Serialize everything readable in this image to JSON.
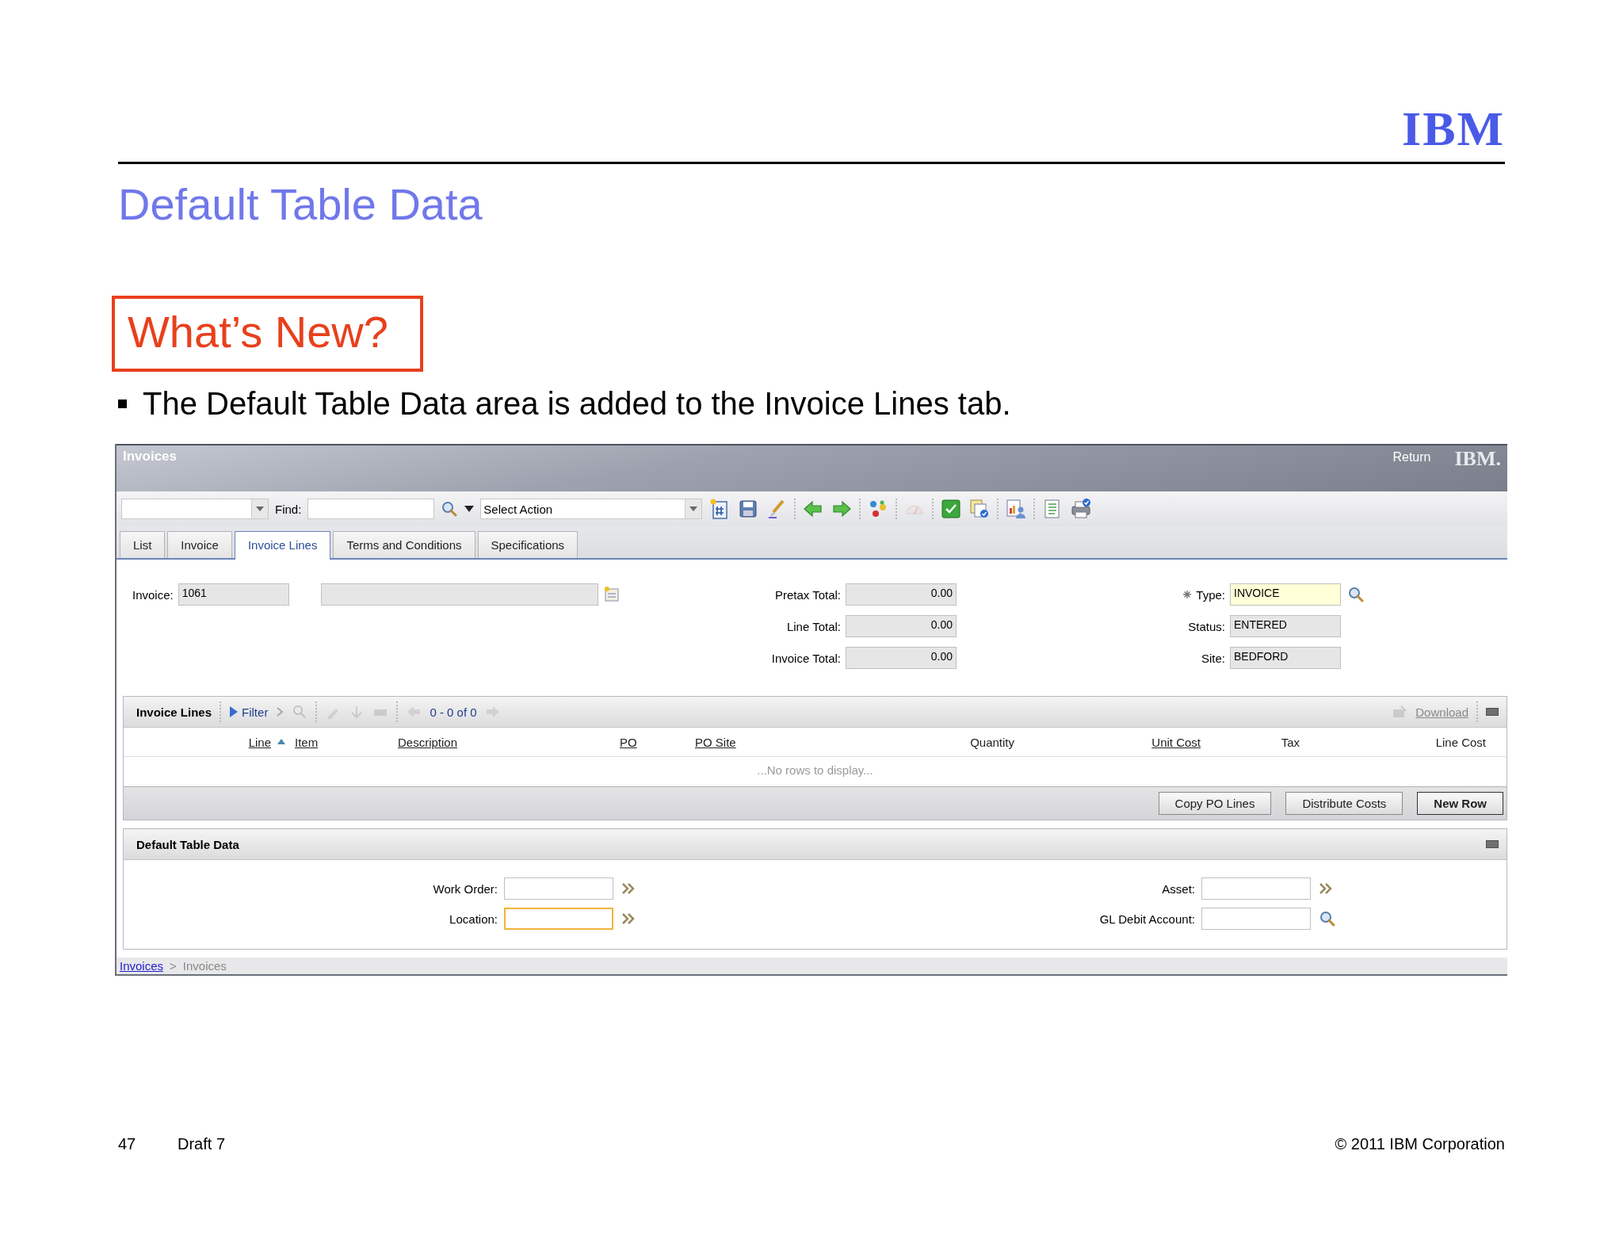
{
  "slide": {
    "logo": "IBM",
    "title": "Default Table Data",
    "callout": "What’s New?",
    "bullets": [
      "The Default Table Data area is added to the Invoice Lines tab."
    ],
    "footer": {
      "page": "47",
      "draft": "Draft 7",
      "copyright": "© 2011 IBM Corporation"
    }
  },
  "app": {
    "title": "Invoices",
    "return_link": "Return",
    "brand": "IBM.",
    "toolbar": {
      "find_label": "Find:",
      "action_placeholder": "Select Action"
    },
    "tabs": [
      {
        "label": "List",
        "selected": false
      },
      {
        "label": "Invoice",
        "selected": false
      },
      {
        "label": "Invoice Lines",
        "selected": true
      },
      {
        "label": "Terms and Conditions",
        "selected": false
      },
      {
        "label": "Specifications",
        "selected": false
      }
    ],
    "header": {
      "invoice": {
        "label": "Invoice:",
        "value": "1061"
      },
      "totals": [
        {
          "label": "Pretax Total:",
          "value": "0.00"
        },
        {
          "label": "Line Total:",
          "value": "0.00"
        },
        {
          "label": "Invoice Total:",
          "value": "0.00"
        }
      ],
      "details": [
        {
          "label": "Type:",
          "value": "INVOICE",
          "required": true
        },
        {
          "label": "Status:",
          "value": "ENTERED",
          "required": false
        },
        {
          "label": "Site:",
          "value": "BEDFORD",
          "required": false
        }
      ]
    },
    "invoice_lines": {
      "title": "Invoice Lines",
      "filter": "Filter",
      "pager": "0 - 0 of 0",
      "download": "Download",
      "columns": [
        {
          "label": "Line",
          "link": true,
          "sorted": true
        },
        {
          "label": "Item",
          "link": true,
          "sorted": false
        },
        {
          "label": "Description",
          "link": true,
          "sorted": false
        },
        {
          "label": "PO",
          "link": true,
          "sorted": false
        },
        {
          "label": "PO Site",
          "link": true,
          "sorted": false
        },
        {
          "label": "Quantity",
          "link": false,
          "sorted": false
        },
        {
          "label": "Unit Cost",
          "link": true,
          "sorted": false
        },
        {
          "label": "Tax",
          "link": false,
          "sorted": false
        },
        {
          "label": "Line Cost",
          "link": false,
          "sorted": false
        }
      ],
      "empty_message": "...No rows to display...",
      "buttons": [
        {
          "label": "Copy PO Lines",
          "primary": false
        },
        {
          "label": "Distribute Costs",
          "primary": false
        },
        {
          "label": "New Row",
          "primary": true
        }
      ]
    },
    "default_table_data": {
      "title": "Default Table Data",
      "fields": [
        {
          "label": "Work Order:",
          "kind": "menu",
          "focused": false
        },
        {
          "label": "Asset:",
          "kind": "menu",
          "focused": false
        },
        {
          "label": "Location:",
          "kind": "menu",
          "focused": true
        },
        {
          "label": "GL Debit Account:",
          "kind": "lookup",
          "focused": false
        }
      ]
    },
    "breadcrumb": {
      "link": "Invoices",
      "separator": ">",
      "current": "Invoices"
    }
  }
}
